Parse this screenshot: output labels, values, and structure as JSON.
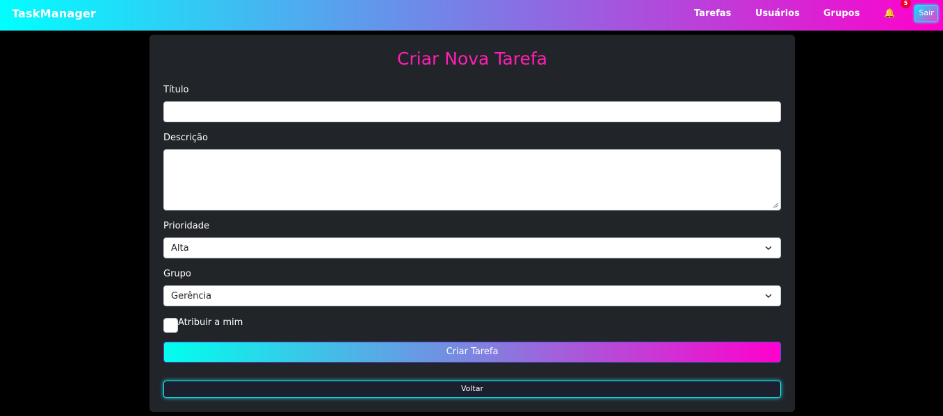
{
  "navbar": {
    "brand": "TaskManager",
    "links": [
      "Tarefas",
      "Usuários",
      "Grupos"
    ],
    "notification_icon": "bell-icon",
    "notification_count": "5",
    "logout_label": "Sair"
  },
  "form": {
    "title": "Criar Nova Tarefa",
    "titulo_label": "Título",
    "titulo_value": "",
    "descricao_label": "Descrição",
    "descricao_value": "",
    "prioridade_label": "Prioridade",
    "prioridade_value": "Alta",
    "grupo_label": "Grupo",
    "grupo_value": "Gerência",
    "assign_label": "Atribuir a mim",
    "assign_checked": false,
    "submit_label": "Criar Tarefa",
    "back_label": "Voltar"
  },
  "colors": {
    "title": "#ff1fb4",
    "card_bg": "#212529",
    "page_bg": "#000000",
    "gradient_start": "#00ffff",
    "gradient_end": "#ff00cc"
  }
}
